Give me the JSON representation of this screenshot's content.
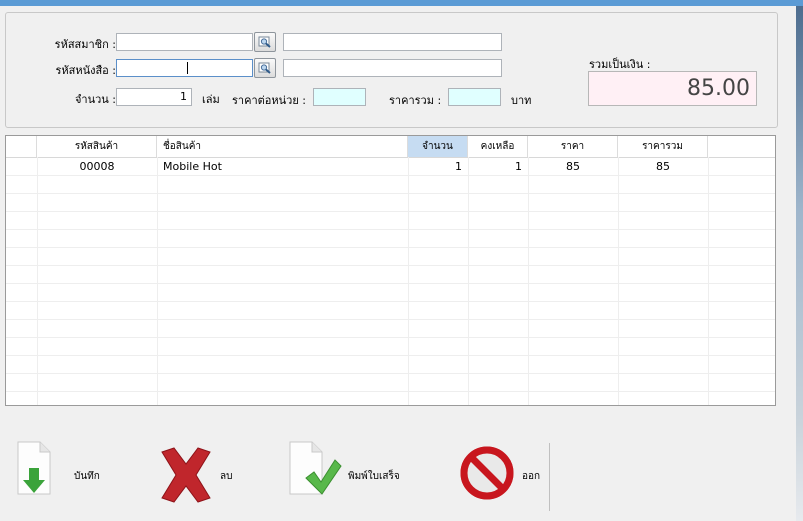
{
  "form": {
    "member_code_label": "รหัสสมาชิก :",
    "member_code_value": "",
    "member_name_value": "",
    "book_code_label": "รหัสหนังสือ :",
    "book_code_value": "",
    "book_name_value": "",
    "quantity_label": "จำนวน :",
    "quantity_value": "1",
    "unit_label": "เล่ม",
    "unit_price_label": "ราคาต่อหน่วย :",
    "unit_price_value": "",
    "total_price_label": "ราคารวม :",
    "total_price_value": "",
    "currency_label": "บาท"
  },
  "summary": {
    "label": "รวมเป็นเงิน :",
    "value": "85.00"
  },
  "table": {
    "columns": [
      "รหัสสินค้า",
      "ชื่อสินค้า",
      "จำนวน",
      "คงเหลือ",
      "ราคา",
      "ราคารวม"
    ],
    "rows": [
      {
        "code": "00008",
        "name": "Mobile Hot",
        "qty": "1",
        "remain": "1",
        "price": "85",
        "total": "85"
      }
    ]
  },
  "actions": {
    "save_label": "บันทึก",
    "delete_label": "ลบ",
    "print_label": "พิมพ์ใบเสร็จ",
    "exit_label": "ออก"
  },
  "icons": {
    "search": "search-icon",
    "save": "save-icon",
    "delete": "delete-icon",
    "print": "print-receipt-icon",
    "exit": "exit-icon"
  },
  "colors": {
    "highlight_field": "#e0ffff",
    "total_background": "#fff0f5",
    "selected_header": "#c6dcf2",
    "delete_red": "#c0262c",
    "save_green": "#3aa33a"
  }
}
